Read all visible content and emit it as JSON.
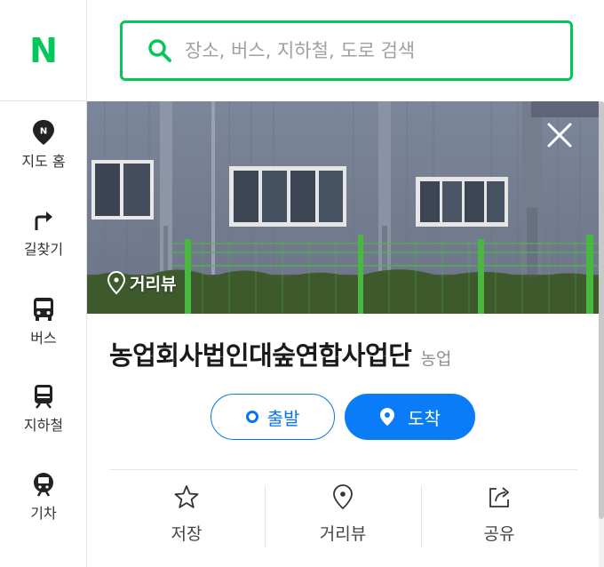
{
  "app": {
    "logo": "N",
    "brand_color": "#03c75a",
    "accent_color": "#0a7cf8"
  },
  "sidebar": {
    "items": [
      {
        "label": "지도 홈",
        "icon": "map-home-icon"
      },
      {
        "label": "길찾기",
        "icon": "directions-icon"
      },
      {
        "label": "버스",
        "icon": "bus-icon"
      },
      {
        "label": "지하철",
        "icon": "subway-icon"
      },
      {
        "label": "기차",
        "icon": "train-icon"
      }
    ]
  },
  "search": {
    "placeholder": "장소, 버스, 지하철, 도로 검색",
    "icon": "search-icon"
  },
  "place": {
    "photo_tag": "거리뷰",
    "name": "농업회사법인대숲연합사업단",
    "category": "농업",
    "start_label": "출발",
    "arrive_label": "도착",
    "actions": [
      {
        "label": "저장",
        "icon": "star-icon"
      },
      {
        "label": "거리뷰",
        "icon": "location-pin-icon"
      },
      {
        "label": "공유",
        "icon": "share-icon"
      }
    ]
  }
}
